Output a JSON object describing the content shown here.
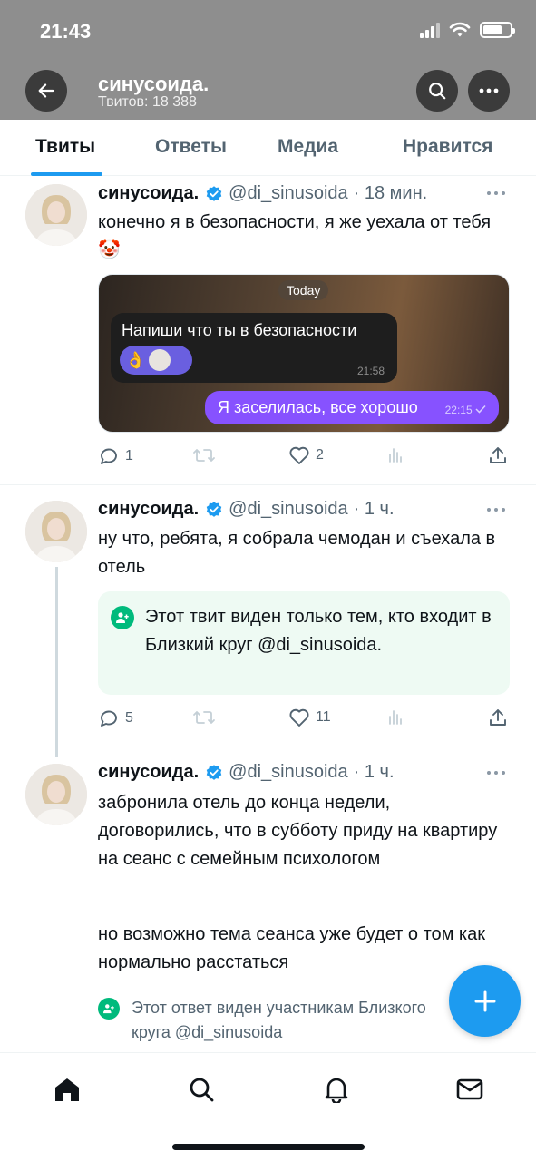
{
  "status_bar": {
    "time": "21:43"
  },
  "header": {
    "title": "синусоида.",
    "subtitle": "Твитов: 18 388",
    "back_icon": "arrow-left-icon",
    "search_icon": "search-icon",
    "more_icon": "more-horizontal-icon"
  },
  "tabs": [
    {
      "label": "Твиты",
      "active": true
    },
    {
      "label": "Ответы",
      "active": false
    },
    {
      "label": "Медиа",
      "active": false
    },
    {
      "label": "Нравится",
      "active": false
    }
  ],
  "tweets": [
    {
      "name": "синусоида.",
      "handle": "@di_sinusoida",
      "time": "· 18 мин.",
      "text": "конечно я в безопасности, я же уехала от тебя 🤡",
      "media": {
        "today_label": "Today",
        "incoming_text": "Напиши что ты в безопасности",
        "incoming_time": "21:58",
        "outgoing_text": "Я заселилась, все хорошо",
        "outgoing_time": "22:15"
      },
      "replies": "1",
      "likes": "2"
    },
    {
      "name": "синусоида.",
      "handle": "@di_sinusoida",
      "time": "· 1 ч.",
      "text": "ну что, ребята, я собрала чемодан и съехала в отель",
      "circle_notice": "Этот твит виден только тем, кто входит в Близкий круг @di_sinusoida.",
      "replies": "5",
      "likes": "11"
    },
    {
      "name": "синусоида.",
      "handle": "@di_sinusoida",
      "time": "· 1 ч.",
      "text_p1": "забронила отель до конца недели, договорились, что в субботу приду на квартиру на сеанс с семейным психологом",
      "text_p2": "но возможно тема сеанса уже будет о том как нормально расстаться",
      "circle_note": "Этот ответ виден участникам Близкого круга @di_sinusoida"
    }
  ],
  "fab": {
    "icon": "plus-icon"
  },
  "bottom_nav": [
    "home-icon",
    "search-icon",
    "bell-icon",
    "mail-icon"
  ],
  "colors": {
    "accent": "#1d9bf0",
    "circle_green": "#00ba7c",
    "header_bg": "#8e8e8e"
  }
}
